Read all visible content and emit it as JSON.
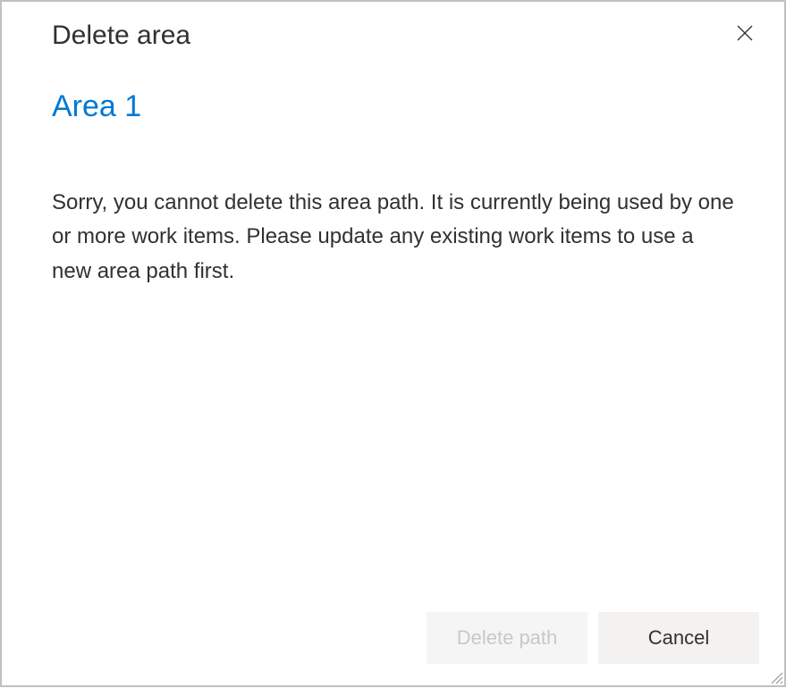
{
  "dialog": {
    "title": "Delete area",
    "area_name": "Area 1",
    "message": "Sorry, you cannot delete this area path. It is currently being used by one or more work items. Please update any existing work items to use a new area path first.",
    "buttons": {
      "delete_path": "Delete path",
      "cancel": "Cancel"
    }
  }
}
